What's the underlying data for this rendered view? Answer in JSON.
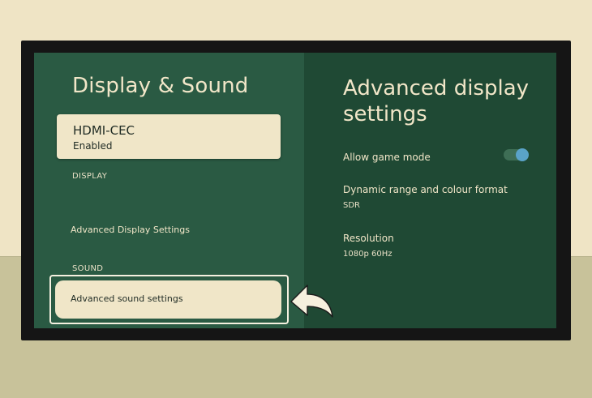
{
  "left": {
    "title": "Display & Sound",
    "hdmi": {
      "title": "HDMI-CEC",
      "status": "Enabled"
    },
    "display_header": "DISPLAY",
    "advanced_display": "Advanced Display Settings",
    "sound_header": "SOUND",
    "advanced_sound": "Advanced sound settings"
  },
  "right": {
    "title": "Advanced display settings",
    "settings": [
      {
        "label": "Allow game mode",
        "toggle_on": true
      },
      {
        "label": "Dynamic range and colour format",
        "value": "SDR"
      },
      {
        "label": "Resolution",
        "value": "1080p 60Hz"
      }
    ]
  },
  "colors": {
    "left_panel": "#2a5a43",
    "right_panel": "#1f4934",
    "card": "#f0e6c8",
    "text_light": "#f1e6c8",
    "toggle_knob": "#5aa3c8"
  },
  "icons": [
    "curved-arrow-icon"
  ]
}
